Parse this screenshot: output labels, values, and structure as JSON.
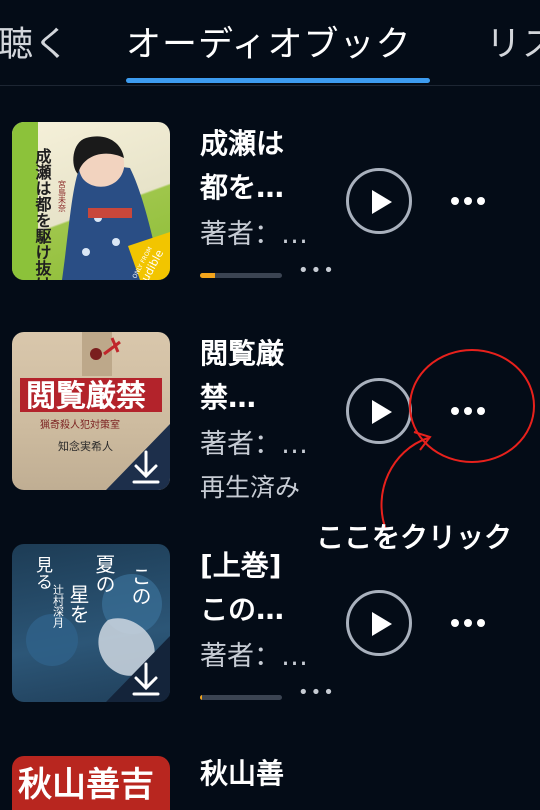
{
  "tabs": [
    {
      "label": "聴く"
    },
    {
      "label": "オーディオブック"
    },
    {
      "label": "リス"
    }
  ],
  "books": [
    {
      "title_line1": "成瀬は",
      "title_line2": "都を…",
      "author": "著者：…",
      "progress_pct": 18,
      "cover": {
        "title": "成瀬は都を駆け抜ける",
        "author": "宮島未奈",
        "badge_top": "ONLY FROM",
        "badge_brand": "audible"
      }
    },
    {
      "title_line1": "閲覧厳",
      "title_line2": "禁…",
      "author": "著者：…",
      "status": "再生済み",
      "cover": {
        "title": "閲覧厳禁",
        "subtitle": "猟奇殺人犯対策室",
        "author": "知念実希人"
      }
    },
    {
      "title_line1": "[上巻]",
      "title_line2": "この…",
      "author": "著者：…",
      "progress_pct": 3,
      "cover": {
        "title_a": "この",
        "title_b": "夏の",
        "title_c": "星を",
        "title_d": "見る",
        "author": "辻村深月"
      }
    },
    {
      "title_line1": "秋山善",
      "cover": {
        "title": "秋山善吉"
      }
    }
  ],
  "annotation": {
    "label": "ここをクリック",
    "color": "#e8211c"
  },
  "colors": {
    "background": "#040c17",
    "tab_accent": "#3d9cf0",
    "progress": "#f3a51c"
  },
  "icons": {
    "play": "play-icon",
    "more": "more-horizontal-icon",
    "download": "download-icon"
  }
}
